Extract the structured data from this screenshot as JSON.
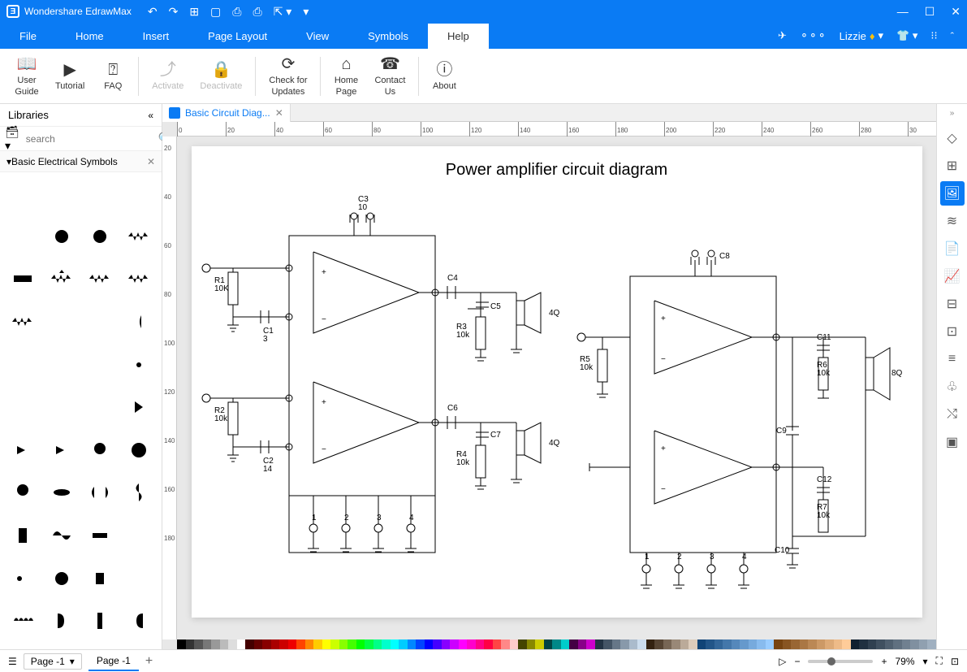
{
  "app": {
    "title": "Wondershare EdrawMax"
  },
  "window": {
    "minimize": "—",
    "maximize": "☐",
    "close": "✕"
  },
  "menubar": {
    "items": [
      "File",
      "Home",
      "Insert",
      "Page Layout",
      "View",
      "Symbols",
      "Help"
    ],
    "active": 6,
    "user": "Lizzie"
  },
  "toolbar": {
    "buttons": [
      {
        "icon": "📖",
        "label": "User\nGuide",
        "disabled": false
      },
      {
        "icon": "▶",
        "label": "Tutorial",
        "disabled": false
      },
      {
        "icon": "?",
        "label": "FAQ",
        "disabled": false
      },
      {
        "icon": "⤴",
        "label": "Activate",
        "disabled": true
      },
      {
        "icon": "🔒",
        "label": "Deactivate",
        "disabled": true
      },
      {
        "icon": "⟳",
        "label": "Check for\nUpdates",
        "disabled": false
      },
      {
        "icon": "⌂",
        "label": "Home\nPage",
        "disabled": false
      },
      {
        "icon": "☎",
        "label": "Contact\nUs",
        "disabled": false
      },
      {
        "icon": "ⓘ",
        "label": "About",
        "disabled": false
      }
    ]
  },
  "libraries": {
    "title": "Libraries",
    "search_placeholder": "search",
    "category": "Basic Electrical Symbols"
  },
  "document": {
    "tab_label": "Basic Circuit Diag...",
    "diagram_title": "Power amplifier circuit diagram"
  },
  "ruler_ticks": [
    "0",
    "20",
    "40",
    "60",
    "80",
    "100",
    "120",
    "140",
    "160",
    "180",
    "200",
    "220",
    "240",
    "260",
    "280",
    "30"
  ],
  "ruler_v_ticks": [
    "20",
    "40",
    "60",
    "80",
    "100",
    "120",
    "140",
    "160",
    "180"
  ],
  "circuit_labels": {
    "c3": "C3",
    "c3v": "10",
    "c4": "C4",
    "c5": "C5",
    "c6": "C6",
    "c7": "C7",
    "c8": "C8",
    "c9": "C9",
    "c10": "C10",
    "c11": "C11",
    "c12": "C12",
    "c1": "C1",
    "c1v": "3",
    "c2": "C2",
    "c2v": "14",
    "r1": "R1",
    "r1v": "10K",
    "r2": "R2",
    "r2v": "10k",
    "r3": "R3",
    "r3v": "10k",
    "r4": "R4",
    "r4v": "10k",
    "r5": "R5",
    "r5v": "10k",
    "r6": "R6",
    "r6v": "10k",
    "r7": "R7",
    "r7v": "10k",
    "q4a": "4Q",
    "q4b": "4Q",
    "q8": "8Q",
    "n1": "1",
    "n2": "2",
    "n3": "3",
    "n4": "4"
  },
  "statusbar": {
    "page_label": "Page -1",
    "page_tab": "Page -1",
    "zoom": "79%"
  },
  "colorbar_colors": [
    "#000",
    "#333",
    "#555",
    "#777",
    "#999",
    "#bbb",
    "#ddd",
    "#fff",
    "#400",
    "#600",
    "#800",
    "#a00",
    "#c00",
    "#e00",
    "#f40",
    "#f80",
    "#fc0",
    "#ff0",
    "#cf0",
    "#8f0",
    "#4f0",
    "#0f0",
    "#0f4",
    "#0f8",
    "#0fc",
    "#0ff",
    "#0cf",
    "#08f",
    "#04f",
    "#00f",
    "#40f",
    "#80f",
    "#c0f",
    "#f0f",
    "#f0c",
    "#f08",
    "#f04",
    "#f44",
    "#f88",
    "#fcc",
    "#440",
    "#880",
    "#cc0",
    "#044",
    "#088",
    "#0cc",
    "#404",
    "#808",
    "#c0c",
    "#234",
    "#456",
    "#678",
    "#89a",
    "#abc",
    "#cde",
    "#321",
    "#543",
    "#765",
    "#987",
    "#ba9",
    "#dcb",
    "#147",
    "#258",
    "#369",
    "#47a",
    "#58b",
    "#69c",
    "#7ad",
    "#8be",
    "#9cf",
    "#741",
    "#852",
    "#963",
    "#a74",
    "#b85",
    "#c96",
    "#da7",
    "#eb8",
    "#fc9",
    "#102030",
    "#203040",
    "#304050",
    "#405060",
    "#506070",
    "#607080",
    "#708090",
    "#8090a0",
    "#90a0b0",
    "#a0b0c0"
  ]
}
